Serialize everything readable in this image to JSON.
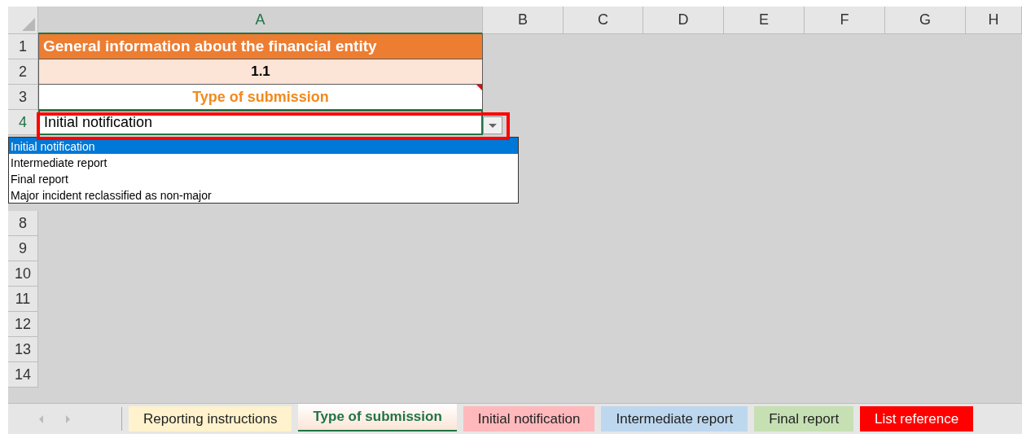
{
  "columns": [
    {
      "label": "A",
      "selected": true
    },
    {
      "label": "B",
      "selected": false
    },
    {
      "label": "C",
      "selected": false
    },
    {
      "label": "D",
      "selected": false
    },
    {
      "label": "E",
      "selected": false
    },
    {
      "label": "F",
      "selected": false
    },
    {
      "label": "G",
      "selected": false
    },
    {
      "label": "H",
      "selected": false
    }
  ],
  "rows": [
    {
      "number": "1",
      "kind": "title",
      "text": "General information about the financial entity"
    },
    {
      "number": "2",
      "kind": "code",
      "text": "1.1"
    },
    {
      "number": "3",
      "kind": "label",
      "text": "Type of submission",
      "comment": true
    },
    {
      "number": "4",
      "kind": "select",
      "text": "Initial notification",
      "selected": true
    },
    {
      "number": "",
      "kind": "hidden"
    },
    {
      "number": "",
      "kind": "hidden"
    },
    {
      "number": "",
      "kind": "hidden"
    },
    {
      "number": "8",
      "kind": "empty"
    },
    {
      "number": "9",
      "kind": "empty"
    },
    {
      "number": "10",
      "kind": "empty"
    },
    {
      "number": "11",
      "kind": "empty"
    },
    {
      "number": "12",
      "kind": "empty"
    },
    {
      "number": "13",
      "kind": "empty"
    },
    {
      "number": "14",
      "kind": "empty"
    }
  ],
  "dropdown": {
    "options": [
      {
        "label": "Initial notification",
        "selected": true
      },
      {
        "label": "Intermediate report",
        "selected": false
      },
      {
        "label": "Final report",
        "selected": false
      },
      {
        "label": "Major incident reclassified as non-major",
        "selected": false
      }
    ]
  },
  "sheet_tabs": [
    {
      "label": "Reporting instructions",
      "selected": false,
      "color": "#fff2cc"
    },
    {
      "label": "Type of submission",
      "selected": true,
      "color": "#fbe5d6"
    },
    {
      "label": "Initial notification",
      "selected": false,
      "color": "#ffb9bd"
    },
    {
      "label": "Intermediate report",
      "selected": false,
      "color": "#bdd7ee"
    },
    {
      "label": "Final report",
      "selected": false,
      "color": "#c6e0b4"
    },
    {
      "label": "List reference",
      "selected": false,
      "color": "#ff0000"
    }
  ]
}
